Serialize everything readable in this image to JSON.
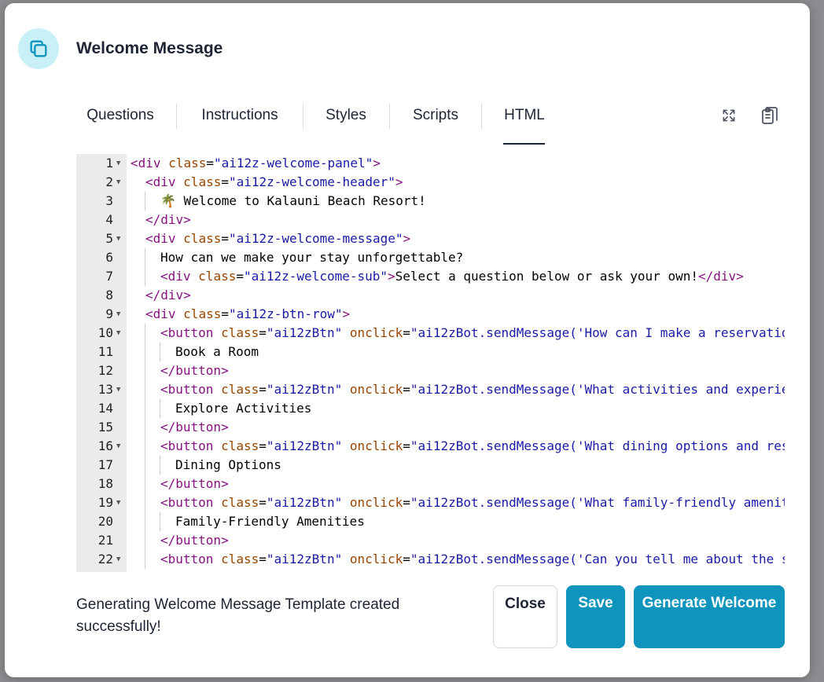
{
  "dialog": {
    "title": "Welcome Message",
    "accent_color": "#0e94bd",
    "icon": "copy-icon"
  },
  "tabs": [
    {
      "label": "Questions",
      "active": false
    },
    {
      "label": "Instructions",
      "active": false
    },
    {
      "label": "Styles",
      "active": false
    },
    {
      "label": "Scripts",
      "active": false
    },
    {
      "label": "HTML",
      "active": true
    }
  ],
  "toolbar": {
    "expand_icon": "expand-icon",
    "copy_icon": "clipboard-copy-icon"
  },
  "editor": {
    "lines": [
      {
        "n": "1",
        "fold": true
      },
      {
        "n": "2",
        "fold": true
      },
      {
        "n": "3",
        "fold": false
      },
      {
        "n": "4",
        "fold": false
      },
      {
        "n": "5",
        "fold": true
      },
      {
        "n": "6",
        "fold": false
      },
      {
        "n": "7",
        "fold": false
      },
      {
        "n": "8",
        "fold": false
      },
      {
        "n": "9",
        "fold": true
      },
      {
        "n": "10",
        "fold": true
      },
      {
        "n": "11",
        "fold": false
      },
      {
        "n": "12",
        "fold": false
      },
      {
        "n": "13",
        "fold": true
      },
      {
        "n": "14",
        "fold": false
      },
      {
        "n": "15",
        "fold": false
      },
      {
        "n": "16",
        "fold": true
      },
      {
        "n": "17",
        "fold": false
      },
      {
        "n": "18",
        "fold": false
      },
      {
        "n": "19",
        "fold": true
      },
      {
        "n": "20",
        "fold": false
      },
      {
        "n": "21",
        "fold": false
      },
      {
        "n": "22",
        "fold": true
      }
    ],
    "code": [
      {
        "indent": 0,
        "parts": [
          [
            "tag",
            "<div "
          ],
          [
            "attr",
            "class"
          ],
          [
            "txt",
            "="
          ],
          [
            "str",
            "\"ai12z-welcome-panel\""
          ],
          [
            "tag",
            ">"
          ]
        ]
      },
      {
        "indent": 1,
        "parts": [
          [
            "tag",
            "<div "
          ],
          [
            "attr",
            "class"
          ],
          [
            "txt",
            "="
          ],
          [
            "str",
            "\"ai12z-welcome-header\""
          ],
          [
            "tag",
            ">"
          ]
        ]
      },
      {
        "indent": 2,
        "parts": [
          [
            "txt",
            "🌴 Welcome to Kalauni Beach Resort!"
          ]
        ]
      },
      {
        "indent": 1,
        "parts": [
          [
            "tag",
            "</div>"
          ]
        ]
      },
      {
        "indent": 1,
        "parts": [
          [
            "tag",
            "<div "
          ],
          [
            "attr",
            "class"
          ],
          [
            "txt",
            "="
          ],
          [
            "str",
            "\"ai12z-welcome-message\""
          ],
          [
            "tag",
            ">"
          ]
        ]
      },
      {
        "indent": 2,
        "parts": [
          [
            "txt",
            "How can we make your stay unforgettable?"
          ]
        ]
      },
      {
        "indent": 2,
        "parts": [
          [
            "tag",
            "<div "
          ],
          [
            "attr",
            "class"
          ],
          [
            "txt",
            "="
          ],
          [
            "str",
            "\"ai12z-welcome-sub\""
          ],
          [
            "tag",
            ">"
          ],
          [
            "txt",
            "Select a question below or ask your own!"
          ],
          [
            "tag",
            "</div>"
          ]
        ]
      },
      {
        "indent": 1,
        "parts": [
          [
            "tag",
            "</div>"
          ]
        ]
      },
      {
        "indent": 1,
        "parts": [
          [
            "tag",
            "<div "
          ],
          [
            "attr",
            "class"
          ],
          [
            "txt",
            "="
          ],
          [
            "str",
            "\"ai12z-btn-row\""
          ],
          [
            "tag",
            ">"
          ]
        ]
      },
      {
        "indent": 2,
        "parts": [
          [
            "tag",
            "<button "
          ],
          [
            "attr",
            "class"
          ],
          [
            "txt",
            "="
          ],
          [
            "str",
            "\"ai12zBtn\""
          ],
          [
            "txt",
            " "
          ],
          [
            "attr",
            "onclick"
          ],
          [
            "txt",
            "="
          ],
          [
            "str",
            "\"ai12zBot.sendMessage('How can I make a reservatio"
          ]
        ]
      },
      {
        "indent": 3,
        "parts": [
          [
            "txt",
            "Book a Room"
          ]
        ]
      },
      {
        "indent": 2,
        "parts": [
          [
            "tag",
            "</button>"
          ]
        ]
      },
      {
        "indent": 2,
        "parts": [
          [
            "tag",
            "<button "
          ],
          [
            "attr",
            "class"
          ],
          [
            "txt",
            "="
          ],
          [
            "str",
            "\"ai12zBtn\""
          ],
          [
            "txt",
            " "
          ],
          [
            "attr",
            "onclick"
          ],
          [
            "txt",
            "="
          ],
          [
            "str",
            "\"ai12zBot.sendMessage('What activities and experie"
          ]
        ]
      },
      {
        "indent": 3,
        "parts": [
          [
            "txt",
            "Explore Activities"
          ]
        ]
      },
      {
        "indent": 2,
        "parts": [
          [
            "tag",
            "</button>"
          ]
        ]
      },
      {
        "indent": 2,
        "parts": [
          [
            "tag",
            "<button "
          ],
          [
            "attr",
            "class"
          ],
          [
            "txt",
            "="
          ],
          [
            "str",
            "\"ai12zBtn\""
          ],
          [
            "txt",
            " "
          ],
          [
            "attr",
            "onclick"
          ],
          [
            "txt",
            "="
          ],
          [
            "str",
            "\"ai12zBot.sendMessage('What dining options and res"
          ]
        ]
      },
      {
        "indent": 3,
        "parts": [
          [
            "txt",
            "Dining Options"
          ]
        ]
      },
      {
        "indent": 2,
        "parts": [
          [
            "tag",
            "</button>"
          ]
        ]
      },
      {
        "indent": 2,
        "parts": [
          [
            "tag",
            "<button "
          ],
          [
            "attr",
            "class"
          ],
          [
            "txt",
            "="
          ],
          [
            "str",
            "\"ai12zBtn\""
          ],
          [
            "txt",
            " "
          ],
          [
            "attr",
            "onclick"
          ],
          [
            "txt",
            "="
          ],
          [
            "str",
            "\"ai12zBot.sendMessage('What family-friendly amenit"
          ]
        ]
      },
      {
        "indent": 3,
        "parts": [
          [
            "txt",
            "Family-Friendly Amenities"
          ]
        ]
      },
      {
        "indent": 2,
        "parts": [
          [
            "tag",
            "</button>"
          ]
        ]
      },
      {
        "indent": 2,
        "parts": [
          [
            "tag",
            "<button "
          ],
          [
            "attr",
            "class"
          ],
          [
            "txt",
            "="
          ],
          [
            "str",
            "\"ai12zBtn\""
          ],
          [
            "txt",
            " "
          ],
          [
            "attr",
            "onclick"
          ],
          [
            "txt",
            "="
          ],
          [
            "str",
            "\"ai12zBot.sendMessage('Can you tell me about the s"
          ]
        ]
      }
    ]
  },
  "footer": {
    "status_text": "Generating Welcome Message Template created successfully!",
    "close_label": "Close",
    "save_label": "Save",
    "generate_label": "Generate Welcome"
  }
}
